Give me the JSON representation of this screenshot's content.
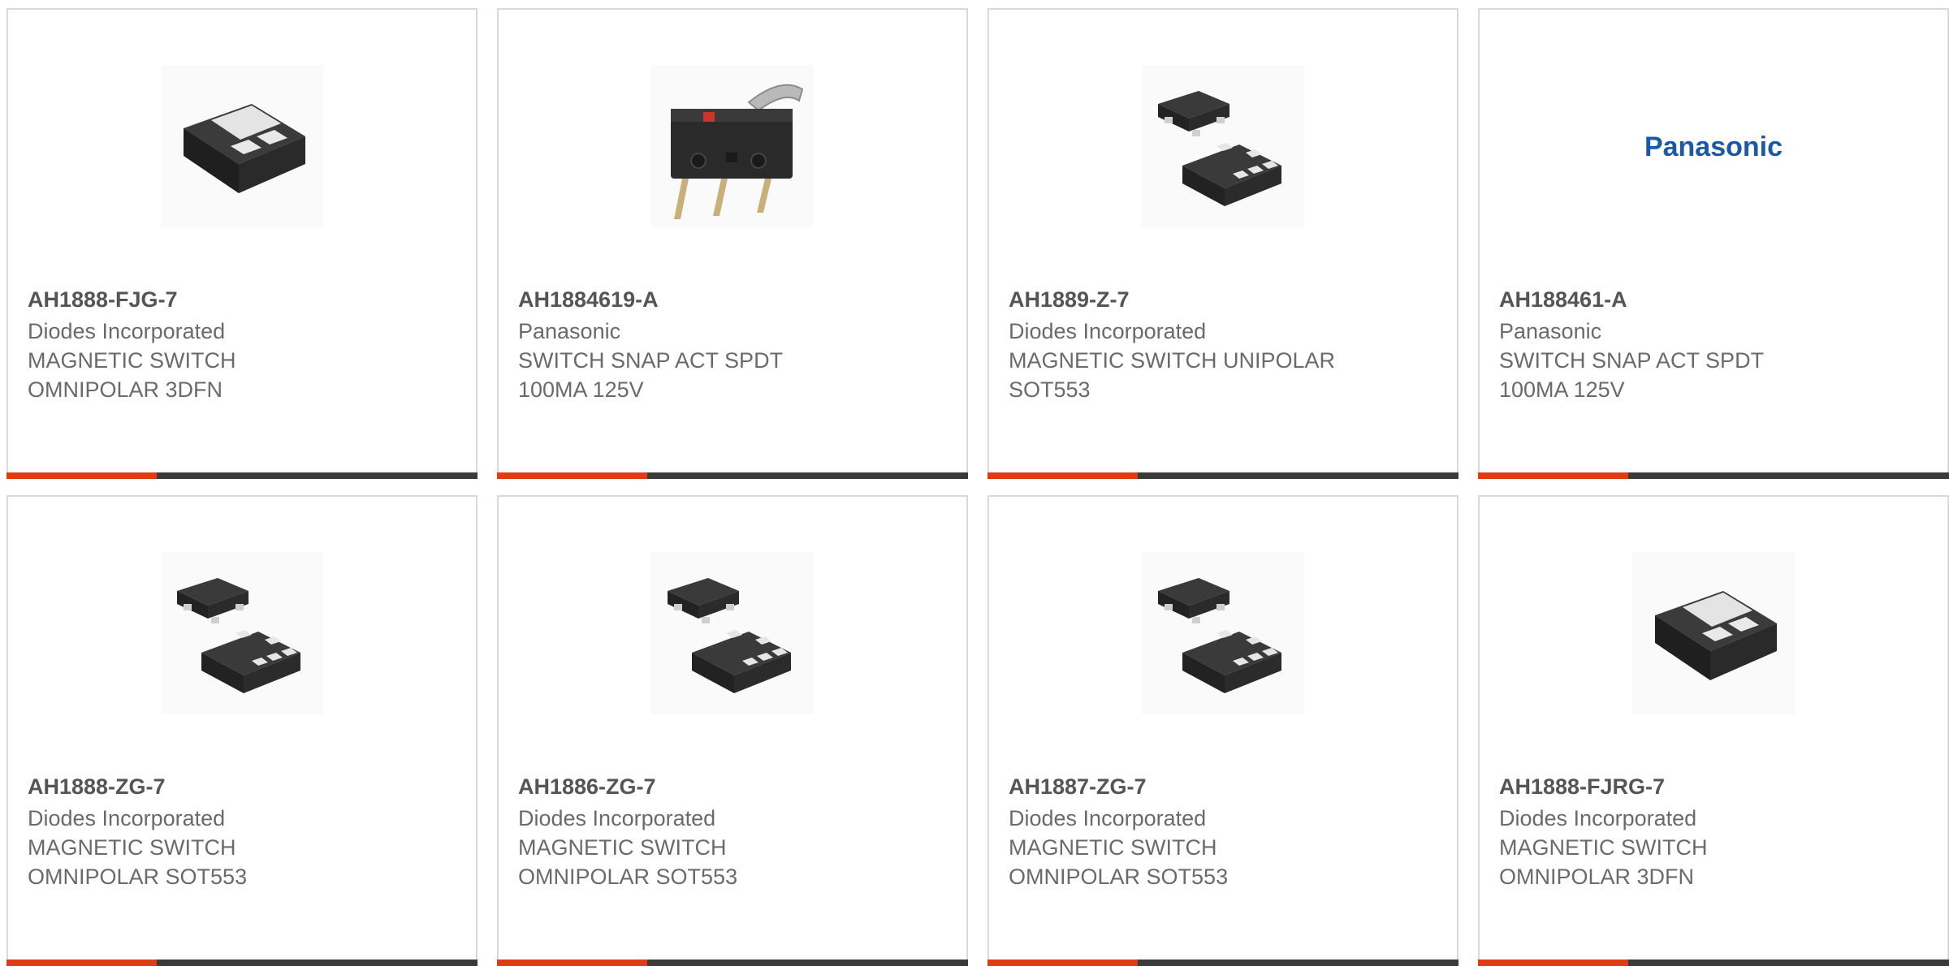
{
  "accent_color": "#e03c14",
  "bar_color": "#3a3a3a",
  "products": [
    {
      "part_number": "AH1888-FJG-7",
      "manufacturer": "Diodes Incorporated",
      "description": "MAGNETIC SWITCH\nOMNIPOLAR 3DFN",
      "image": "dfn-package-icon"
    },
    {
      "part_number": "AH1884619-A",
      "manufacturer": "Panasonic",
      "description": "SWITCH SNAP ACT SPDT\n100MA 125V",
      "image": "snap-switch-icon"
    },
    {
      "part_number": "AH1889-Z-7",
      "manufacturer": "Diodes Incorporated",
      "description": "MAGNETIC SWITCH UNIPOLAR\nSOT553",
      "image": "sot553-package-icon"
    },
    {
      "part_number": "AH188461-A",
      "manufacturer": "Panasonic",
      "description": "SWITCH SNAP ACT SPDT\n100MA 125V",
      "image": "panasonic-logo",
      "logo_text": "Panasonic"
    },
    {
      "part_number": "AH1888-ZG-7",
      "manufacturer": "Diodes Incorporated",
      "description": "MAGNETIC SWITCH\nOMNIPOLAR SOT553",
      "image": "sot553-package-icon"
    },
    {
      "part_number": "AH1886-ZG-7",
      "manufacturer": "Diodes Incorporated",
      "description": "MAGNETIC SWITCH\nOMNIPOLAR SOT553",
      "image": "sot553-package-icon"
    },
    {
      "part_number": "AH1887-ZG-7",
      "manufacturer": "Diodes Incorporated",
      "description": "MAGNETIC SWITCH\nOMNIPOLAR SOT553",
      "image": "sot553-package-icon"
    },
    {
      "part_number": "AH1888-FJRG-7",
      "manufacturer": "Diodes Incorporated",
      "description": "MAGNETIC SWITCH\nOMNIPOLAR 3DFN",
      "image": "dfn-package-icon"
    }
  ]
}
